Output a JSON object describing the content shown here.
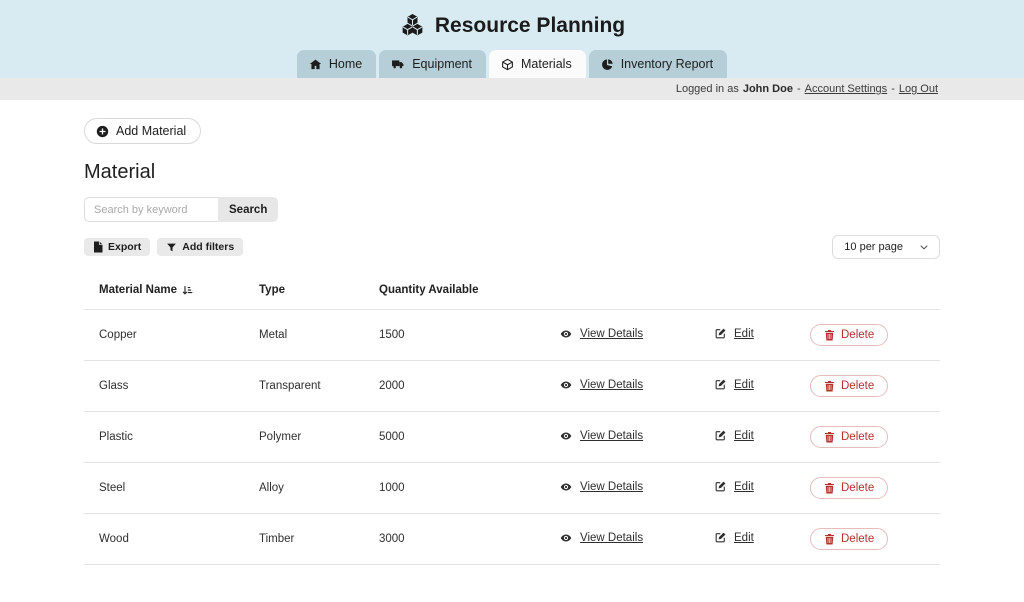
{
  "header": {
    "title": "Resource Planning",
    "tabs": [
      {
        "label": "Home",
        "icon": "home-icon",
        "active": false
      },
      {
        "label": "Equipment",
        "icon": "truck-icon",
        "active": false
      },
      {
        "label": "Materials",
        "icon": "cube-icon",
        "active": true
      },
      {
        "label": "Inventory Report",
        "icon": "pie-chart-icon",
        "active": false
      }
    ]
  },
  "user_bar": {
    "prefix": "Logged in as",
    "username": "John Doe",
    "separator": "-",
    "links": {
      "account_settings": "Account Settings",
      "log_out": "Log Out"
    }
  },
  "actions_bar": {
    "add_material": "Add Material"
  },
  "page": {
    "title": "Material"
  },
  "search": {
    "placeholder": "Search by keyword",
    "button": "Search"
  },
  "toolbar": {
    "export": "Export",
    "add_filters": "Add filters",
    "per_page": "10 per page"
  },
  "table": {
    "columns": [
      "Material Name",
      "Type",
      "Quantity Available"
    ],
    "sorted_column": "Material Name",
    "actions": {
      "view": "View Details",
      "edit": "Edit",
      "delete": "Delete"
    },
    "rows": [
      {
        "name": "Copper",
        "type": "Metal",
        "quantity": "1500"
      },
      {
        "name": "Glass",
        "type": "Transparent",
        "quantity": "2000"
      },
      {
        "name": "Plastic",
        "type": "Polymer",
        "quantity": "5000"
      },
      {
        "name": "Steel",
        "type": "Alloy",
        "quantity": "1000"
      },
      {
        "name": "Wood",
        "type": "Timber",
        "quantity": "3000"
      }
    ]
  },
  "icons": {
    "boxes-stacked-icon": "three 3D cubes",
    "home-icon": "house",
    "truck-icon": "delivery truck",
    "cube-icon": "3D box",
    "pie-chart-icon": "pie chart",
    "plus-circle-icon": "circled plus",
    "file-icon": "document",
    "funnel-icon": "filter funnel",
    "sort-asc-icon": "down arrow with widening bars",
    "eye-icon": "eye",
    "edit-icon": "pen on square",
    "trash-icon": "trash can",
    "chevron-down-icon": "chevron down"
  },
  "colors": {
    "header_bg": "#d9ebf2",
    "tab_inactive_bg": "#b5ced8",
    "tab_active_bg": "#fbfbfb",
    "user_bar_bg": "#e9e9e9",
    "button_gray_bg": "#e9e9e9",
    "delete_red": "#b23230",
    "delete_border": "#e6bdbb",
    "table_divider": "#e3e3e3"
  }
}
